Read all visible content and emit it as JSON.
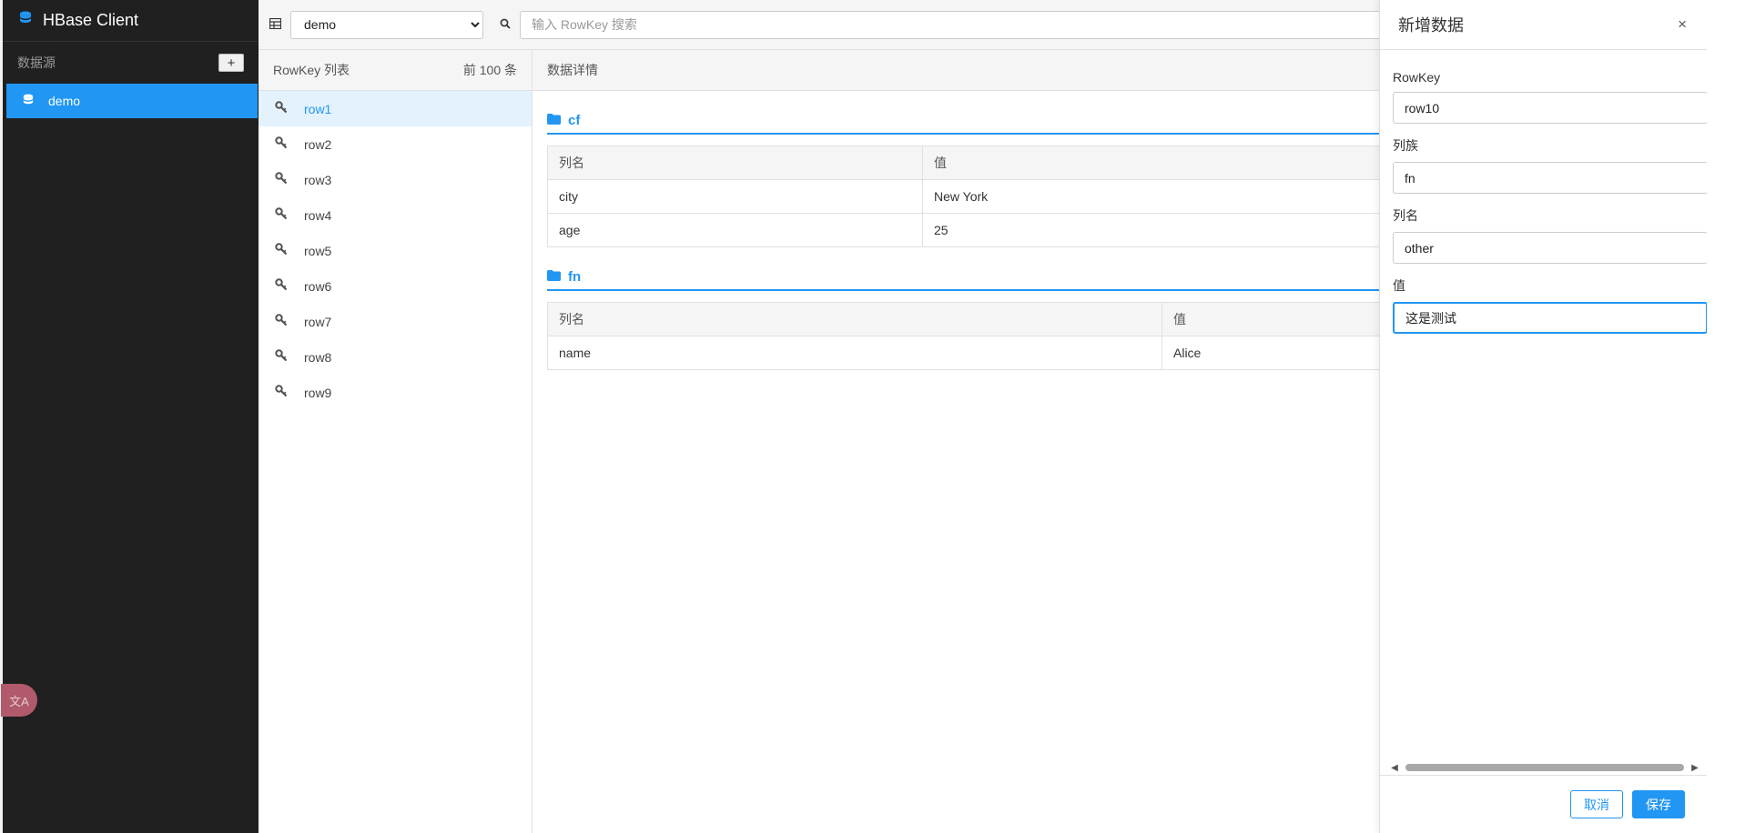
{
  "app": {
    "title": "HBase Client"
  },
  "sidebar": {
    "section_label": "数据源",
    "add_label": "+",
    "datasources": [
      {
        "label": "demo",
        "active": true
      }
    ],
    "translate_label": "文A"
  },
  "toolbar": {
    "table_selected": "demo",
    "search_placeholder": "输入 RowKey 搜索"
  },
  "rowkey_panel": {
    "title": "RowKey 列表",
    "count_label": "前 100 条",
    "items": [
      "row1",
      "row2",
      "row3",
      "row4",
      "row5",
      "row6",
      "row7",
      "row8",
      "row9"
    ],
    "active_index": 0
  },
  "detail": {
    "title": "数据详情",
    "families": [
      {
        "name": "cf",
        "headers": [
          "列名",
          "值"
        ],
        "rows": [
          [
            "city",
            "New York"
          ],
          [
            "age",
            "25"
          ]
        ]
      },
      {
        "name": "fn",
        "headers": [
          "列名",
          "值"
        ],
        "rows": [
          [
            "name",
            "Alice"
          ]
        ]
      }
    ]
  },
  "drawer": {
    "title": "新增数据",
    "close_label": "×",
    "fields": {
      "rowkey": {
        "label": "RowKey",
        "value": "row10"
      },
      "family": {
        "label": "列族",
        "value": "fn"
      },
      "column": {
        "label": "列名",
        "value": "other"
      },
      "value": {
        "label": "值",
        "value": "这是测试"
      }
    },
    "cancel_label": "取消",
    "save_label": "保存"
  },
  "colors": {
    "accent": "#2196f3",
    "sidebar_bg": "#202020",
    "active_row_bg": "#e3f2fd"
  }
}
